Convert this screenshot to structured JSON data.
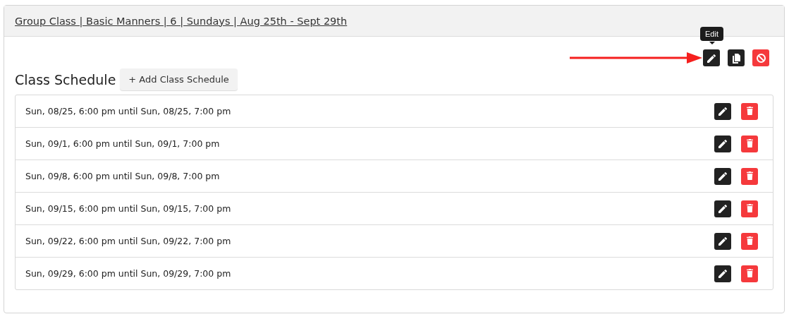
{
  "card": {
    "title": "Group Class | Basic Manners | 6 | Sundays | Aug 25th - Sept 29th"
  },
  "tooltip": {
    "text": "Edit"
  },
  "annotation": {
    "kind": "arrow"
  },
  "toolbar": [
    {
      "kind": "edit"
    },
    {
      "kind": "copy"
    },
    {
      "kind": "cancel"
    }
  ],
  "section": {
    "heading": "Class Schedule",
    "add_button": "+ Add Class Schedule"
  },
  "schedule": [
    {
      "text": "Sun, 08/25, 6:00 pm until Sun, 08/25, 7:00 pm"
    },
    {
      "text": "Sun, 09/1, 6:00 pm until Sun, 09/1, 7:00 pm"
    },
    {
      "text": "Sun, 09/8, 6:00 pm until Sun, 09/8, 7:00 pm"
    },
    {
      "text": "Sun, 09/15, 6:00 pm until Sun, 09/15, 7:00 pm"
    },
    {
      "text": "Sun, 09/22, 6:00 pm until Sun, 09/22, 7:00 pm"
    },
    {
      "text": "Sun, 09/29, 6:00 pm until Sun, 09/29, 7:00 pm"
    }
  ]
}
